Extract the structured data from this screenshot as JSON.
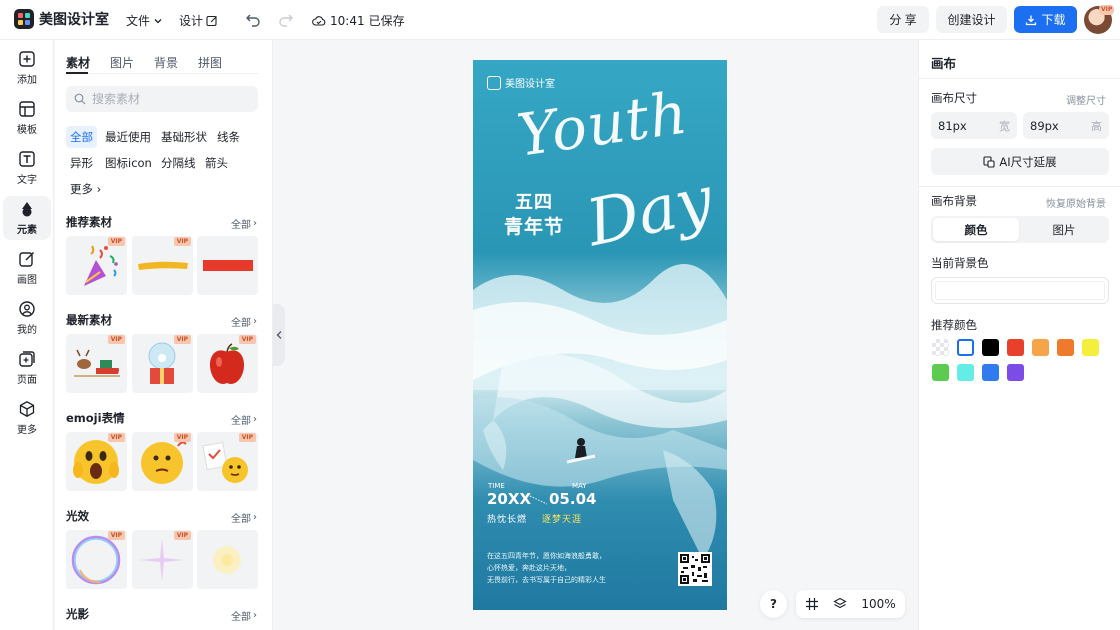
{
  "app": {
    "name": "美图设计室"
  },
  "topbar": {
    "menu_file": "文件",
    "menu_design": "设计",
    "save_time": "10:41",
    "save_status": "已保存",
    "share": "分 享",
    "create": "创建设计",
    "download": "下载",
    "avatar_badge": "VIP"
  },
  "rail": {
    "items": [
      {
        "label": "添加",
        "icon": "plus-square-icon"
      },
      {
        "label": "模板",
        "icon": "template-icon"
      },
      {
        "label": "文字",
        "icon": "text-icon"
      },
      {
        "label": "元素",
        "icon": "shapes-icon"
      },
      {
        "label": "画图",
        "icon": "draw-icon"
      },
      {
        "label": "我的",
        "icon": "user-icon"
      },
      {
        "label": "页面",
        "icon": "page-add-icon"
      },
      {
        "label": "更多",
        "icon": "cube-icon"
      }
    ],
    "active": "元素"
  },
  "panel": {
    "tabs": [
      "素材",
      "图片",
      "背景",
      "拼图"
    ],
    "search_placeholder": "搜索素材",
    "chips": [
      "全部",
      "最近使用",
      "基础形状",
      "线条",
      "异形",
      "图标icon",
      "分隔线",
      "箭头",
      "更多"
    ],
    "all_label": "全部",
    "vip_label": "VIP",
    "sections": [
      {
        "title": "推荐素材"
      },
      {
        "title": "最新素材"
      },
      {
        "title": "emoji表情"
      },
      {
        "title": "光效"
      },
      {
        "title": "光影"
      }
    ]
  },
  "poster": {
    "brand": "美图设计室",
    "youth": "Youth",
    "day": "Day",
    "cn_line1": "五四",
    "cn_line2": "青年节",
    "time_label": "TIME",
    "time_value": "20XX",
    "date_label": "MAY",
    "date_value": "05.04",
    "slogan_left": "热忱长燃",
    "slogan_right": "逐梦天涯",
    "para": [
      "在这五四青年节，愿你如海浪般勇敢，",
      "心怀热爱，奔赴这片天地，",
      "无畏前行，去书写属于自己的精彩人生"
    ]
  },
  "canvas_controls": {
    "help": "?",
    "zoom": "100%"
  },
  "right_panel": {
    "title": "画布",
    "size_label": "画布尺寸",
    "size_link": "调整尺寸",
    "width_value": "81px",
    "width_unit": "宽",
    "height_value": "89px",
    "height_unit": "高",
    "ai_extend": "AI尺寸延展",
    "bg_label": "画布背景",
    "bg_link": "恢复原始背景",
    "seg_color": "颜色",
    "seg_image": "图片",
    "current_bg": "当前背景色",
    "recommended": "推荐颜色",
    "swatches": [
      "transparent",
      "#ffffff",
      "#000000",
      "#e8402a",
      "#f5a44a",
      "#ef7a2b",
      "#f4ee3d",
      "#5ccb4f",
      "#64ece6",
      "#2f7bef",
      "#7c4ce6"
    ]
  }
}
